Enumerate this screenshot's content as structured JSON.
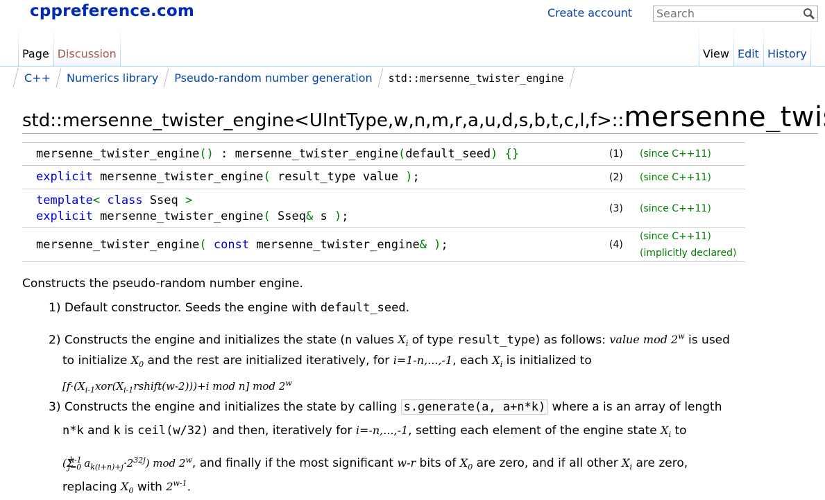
{
  "header": {
    "logo": "cppreference.com",
    "create_account": "Create account",
    "search_placeholder": "Search"
  },
  "tabs": {
    "left": [
      "Page",
      "Discussion"
    ],
    "right": [
      "View",
      "Edit",
      "History"
    ]
  },
  "breadcrumb": [
    "C++",
    "Numerics library",
    "Pseudo-random number generation",
    "std::mersenne_twister_engine"
  ],
  "title": {
    "prefix": "std::mersenne_twister_engine<UIntType,w,n,m,r,a,u,d,s,b,t,c,l,f>::",
    "name": "mersenne_twister_engine"
  },
  "declarations": [
    {
      "num": "(1)",
      "since": "(since C++11)",
      "note": ""
    },
    {
      "num": "(2)",
      "since": "(since C++11)",
      "note": ""
    },
    {
      "num": "(3)",
      "since": "(since C++11)",
      "note": ""
    },
    {
      "num": "(4)",
      "since": "(since C++11)",
      "note": "(implicitly declared)"
    }
  ],
  "body": {
    "intro": "Constructs the pseudo-random number engine.",
    "item1_text": "1) Default constructor. Seeds the engine with ",
    "item1_code": "default_seed",
    "item1_end": "."
  }
}
